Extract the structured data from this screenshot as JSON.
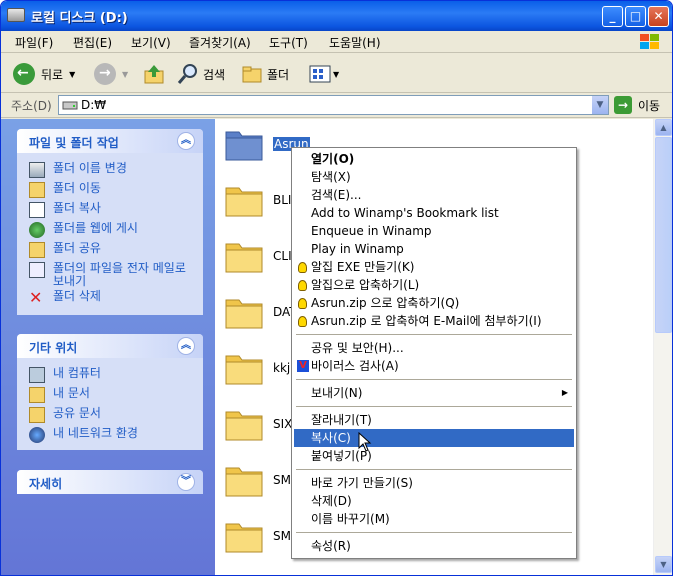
{
  "window": {
    "title": "로컬 디스크 (D:)"
  },
  "menu": [
    "파일(F)",
    "편집(E)",
    "보기(V)",
    "즐겨찾기(A)",
    "도구(T)",
    "도움말(H)"
  ],
  "toolbar": {
    "back": "뒤로",
    "search": "검색",
    "folders": "폴더"
  },
  "address": {
    "label": "주소(D)",
    "value": "D:₩",
    "go": "이동"
  },
  "left": {
    "tasks_title": "파일 및 폴더 작업",
    "tasks": [
      "폴더 이름 변경",
      "폴더 이동",
      "폴더 복사",
      "폴더를 웹에 게시",
      "폴더 공유",
      "폴더의 파일을 전자 메일로 보내기",
      "폴더 삭제"
    ],
    "places_title": "기타 위치",
    "places": [
      "내 컴퓨터",
      "내 문서",
      "공유 문서",
      "내 네트워크 환경"
    ],
    "details_title": "자세히"
  },
  "folders": [
    "Asrun",
    "BLI",
    "CLI",
    "DAT",
    "kkj",
    "SIX",
    "SM",
    "SM"
  ],
  "context_menu": {
    "items": [
      "열기(O)",
      "탐색(X)",
      "검색(E)...",
      "Add to Winamp's Bookmark list",
      "Enqueue in Winamp",
      "Play in Winamp",
      "알집 EXE 만들기(K)",
      "알집으로 압축하기(L)",
      "Asrun.zip 으로 압축하기(Q)",
      "Asrun.zip 로 압축하여 E-Mail에 첨부하기(I)",
      "공유 및 보안(H)...",
      "바이러스 검사(A)",
      "보내기(N)",
      "잘라내기(T)",
      "복사(C)",
      "붙여넣기(P)",
      "바로 가기 만들기(S)",
      "삭제(D)",
      "이름 바꾸기(M)",
      "속성(R)"
    ],
    "highlighted": "복사(C)"
  },
  "colors": {
    "titlebar": "#0a5fe8",
    "panel_text": "#215dc6",
    "highlight": "#316ac5"
  }
}
